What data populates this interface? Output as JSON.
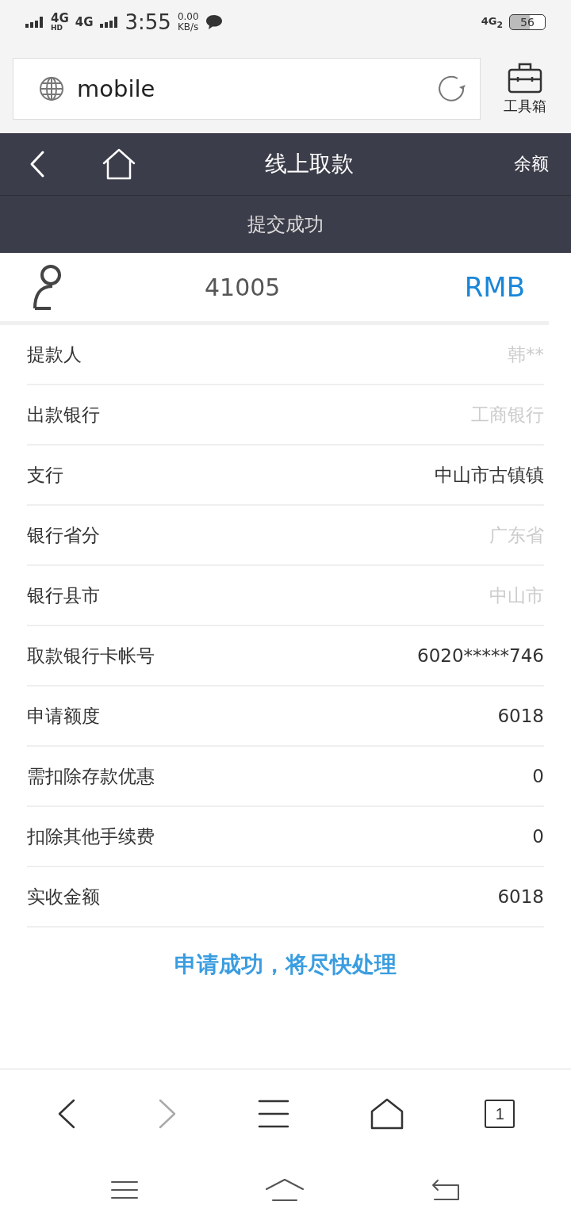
{
  "status_bar": {
    "network_1": "4G",
    "network_1_sup": "HD",
    "network_2": "4G",
    "time": "3:55",
    "speed": "0.00",
    "speed_unit": "KB/s",
    "right_network": "4G",
    "right_network_sub": "2",
    "battery": "56"
  },
  "browser": {
    "url": "mobile",
    "toolbox_label": "工具箱"
  },
  "nav": {
    "title": "线上取款",
    "right_link": "余额"
  },
  "banner": "提交成功",
  "account": {
    "number": "41005",
    "currency": "RMB"
  },
  "rows": [
    {
      "label": "提款人",
      "value": "韩**",
      "faded": true
    },
    {
      "label": "出款银行",
      "value": "工商银行",
      "faded": true
    },
    {
      "label": "支行",
      "value": "中山市古镇镇",
      "faded": false
    },
    {
      "label": "银行省分",
      "value": "广东省",
      "faded": true
    },
    {
      "label": "银行县市",
      "value": "中山市",
      "faded": true
    },
    {
      "label": "取款银行卡帐号",
      "value": "6020*****746",
      "faded": false
    },
    {
      "label": "申请额度",
      "value": "6018",
      "faded": false
    },
    {
      "label": "需扣除存款优惠",
      "value": "0",
      "faded": false
    },
    {
      "label": "扣除其他手续费",
      "value": "0",
      "faded": false
    },
    {
      "label": "实收金额",
      "value": "6018",
      "faded": false
    }
  ],
  "message": "申请成功，将尽快处理",
  "tabs_button": "1"
}
